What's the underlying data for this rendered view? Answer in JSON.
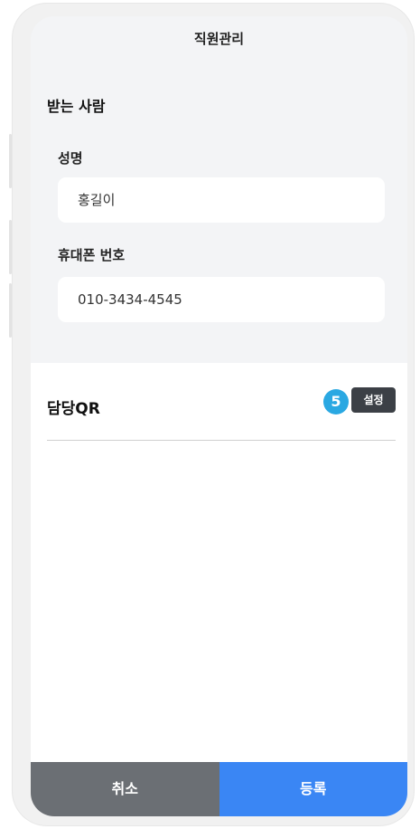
{
  "header": {
    "title": "직원관리"
  },
  "recipient": {
    "heading": "받는 사람",
    "name_label": "성명",
    "name_value": "홍길이",
    "phone_label": "휴대폰 번호",
    "phone_value": "010-3434-4545"
  },
  "qr": {
    "title": "담당QR",
    "badge": "5",
    "set_label": "설정"
  },
  "footer": {
    "cancel_label": "취소",
    "register_label": "등록"
  },
  "colors": {
    "badge": "#2aa8e2",
    "set_button": "#3c4046",
    "cancel": "#6b6f74",
    "register": "#3a86f4"
  }
}
